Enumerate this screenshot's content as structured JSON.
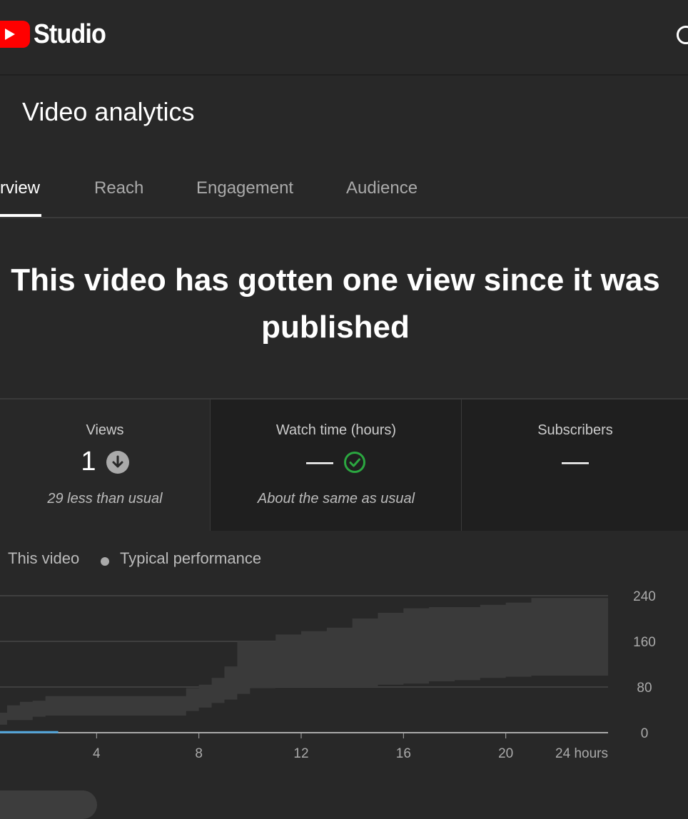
{
  "app": {
    "name": "Studio",
    "icon": "youtube-play-logo",
    "search_icon": "search-icon"
  },
  "page": {
    "title": "Video analytics"
  },
  "tabs": [
    {
      "label": "rview",
      "active": true
    },
    {
      "label": "Reach",
      "active": false
    },
    {
      "label": "Engagement",
      "active": false
    },
    {
      "label": "Audience",
      "active": false
    }
  ],
  "headline": "This video has gotten one view since it was published",
  "stats": [
    {
      "label": "Views",
      "value": "1",
      "icon": "arrow-down-icon",
      "note": "29 less than usual"
    },
    {
      "label": "Watch time (hours)",
      "value": "—",
      "icon": "check-circle-icon",
      "note": "About the same as usual"
    },
    {
      "label": "Subscribers",
      "value": "—"
    }
  ],
  "legend": [
    {
      "label": "This video"
    },
    {
      "label": "Typical performance"
    }
  ],
  "colors": {
    "background": "#282828",
    "panel_dark": "#1f1f1f",
    "brand_red": "#ff0000",
    "this_video_line": "#4fa3d9",
    "typical_band": "#3a3a3a",
    "check_green": "#2ba640",
    "down_badge": "#aaaaaa"
  },
  "chart_data": {
    "type": "area",
    "x_unit": "hours",
    "xlim": [
      0,
      24
    ],
    "ylim": [
      0,
      240
    ],
    "x_ticks": [
      "4",
      "8",
      "12",
      "16",
      "20",
      "24 hours"
    ],
    "y_ticks": [
      "240",
      "160",
      "80",
      "0"
    ],
    "grid": true,
    "series": [
      {
        "name": "This video",
        "x": [
          0,
          2.5
        ],
        "y": [
          1,
          1
        ]
      },
      {
        "name": "Typical performance",
        "x": [
          0,
          0.5,
          1,
          1.5,
          2,
          3,
          4,
          5,
          6,
          7,
          7.5,
          8,
          8.5,
          9,
          9.5,
          10,
          11,
          12,
          13,
          14,
          15,
          16,
          17,
          18,
          19,
          20,
          21,
          22,
          23,
          24
        ],
        "lower": [
          14,
          22,
          22,
          28,
          30,
          30,
          30,
          30,
          30,
          30,
          38,
          44,
          52,
          58,
          68,
          78,
          80,
          80,
          80,
          80,
          84,
          86,
          90,
          92,
          96,
          98,
          100,
          100,
          100,
          100
        ],
        "upper": [
          35,
          48,
          54,
          56,
          64,
          64,
          64,
          64,
          64,
          64,
          78,
          84,
          96,
          116,
          160,
          160,
          172,
          178,
          184,
          200,
          210,
          218,
          220,
          220,
          224,
          228,
          236,
          236,
          236,
          236
        ]
      }
    ]
  }
}
